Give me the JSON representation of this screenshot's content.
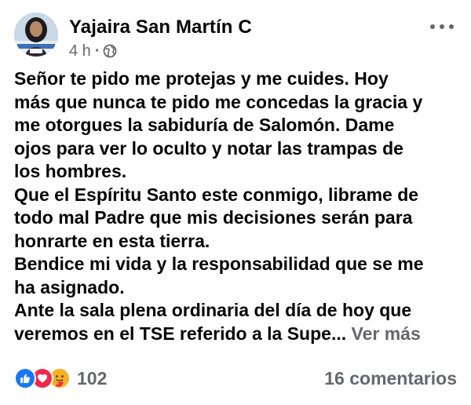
{
  "post": {
    "author": "Yajaira San Martín C",
    "time": "4 h",
    "separator": "·",
    "lines": [
      "Señor te pido me protejas y me cuides. Hoy",
      "más que nunca te pido me concedas la gracia y",
      "me otorgues la sabiduría de Salomón. Dame",
      "ojos para  ver lo oculto y notar las trampas de",
      "los hombres.",
      "Que el Espíritu Santo este conmigo, librame de",
      "todo mal Padre que mis decisiones serán para",
      "honrarte en esta tierra.",
      "Bendice mi vida y la responsabilidad que se me",
      "ha asignado.",
      "Ante la sala plena ordinaria del día de hoy que",
      "veremos en el TSE referido a la Supe... "
    ],
    "see_more": "Ver más",
    "reaction_count": "102",
    "comments": "16 comentarios"
  },
  "icons": {
    "audience": "globe-icon",
    "reactions": [
      "like-icon",
      "love-icon",
      "care-icon"
    ],
    "menu": "more-options-icon"
  },
  "colors": {
    "text": "#050505",
    "secondary": "#65676b",
    "like": "#1877f2",
    "love": "#f0284a",
    "care": "#f7b125"
  }
}
